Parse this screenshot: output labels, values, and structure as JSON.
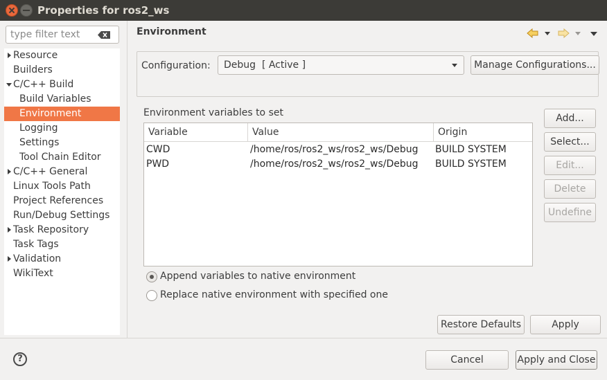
{
  "window": {
    "title": "Properties for ros2_ws"
  },
  "filter": {
    "placeholder": "type filter text"
  },
  "tree": [
    {
      "label": "Resource",
      "expandable": true,
      "expanded": false,
      "level": 0,
      "selected": false
    },
    {
      "label": "Builders",
      "expandable": false,
      "level": 0,
      "selected": false
    },
    {
      "label": "C/C++ Build",
      "expandable": true,
      "expanded": true,
      "level": 0,
      "selected": false
    },
    {
      "label": "Build Variables",
      "expandable": false,
      "level": 1,
      "selected": false
    },
    {
      "label": "Environment",
      "expandable": false,
      "level": 1,
      "selected": true
    },
    {
      "label": "Logging",
      "expandable": false,
      "level": 1,
      "selected": false
    },
    {
      "label": "Settings",
      "expandable": false,
      "level": 1,
      "selected": false
    },
    {
      "label": "Tool Chain Editor",
      "expandable": false,
      "level": 1,
      "selected": false
    },
    {
      "label": "C/C++ General",
      "expandable": true,
      "expanded": false,
      "level": 0,
      "selected": false
    },
    {
      "label": "Linux Tools Path",
      "expandable": false,
      "level": 0,
      "selected": false
    },
    {
      "label": "Project References",
      "expandable": false,
      "level": 0,
      "selected": false
    },
    {
      "label": "Run/Debug Settings",
      "expandable": false,
      "level": 0,
      "selected": false
    },
    {
      "label": "Task Repository",
      "expandable": true,
      "expanded": false,
      "level": 0,
      "selected": false
    },
    {
      "label": "Task Tags",
      "expandable": false,
      "level": 0,
      "selected": false
    },
    {
      "label": "Validation",
      "expandable": true,
      "expanded": false,
      "level": 0,
      "selected": false
    },
    {
      "label": "WikiText",
      "expandable": false,
      "level": 0,
      "selected": false
    }
  ],
  "page": {
    "title": "Environment"
  },
  "config": {
    "label": "Configuration:",
    "selected": "Debug  [ Active ]",
    "manage_label": "Manage Configurations..."
  },
  "env": {
    "section_label": "Environment variables to set",
    "columns": [
      "Variable",
      "Value",
      "Origin"
    ],
    "rows": [
      {
        "variable": "CWD",
        "value": "/home/ros/ros2_ws/ros2_ws/Debug",
        "origin": "BUILD SYSTEM"
      },
      {
        "variable": "PWD",
        "value": "/home/ros/ros2_ws/ros2_ws/Debug",
        "origin": "BUILD SYSTEM"
      }
    ]
  },
  "side_buttons": [
    {
      "label": "Add...",
      "enabled": true
    },
    {
      "label": "Select...",
      "enabled": true
    },
    {
      "label": "Edit...",
      "enabled": false
    },
    {
      "label": "Delete",
      "enabled": false
    },
    {
      "label": "Undefine",
      "enabled": false
    }
  ],
  "options": {
    "append_label": "Append variables to native environment",
    "replace_label": "Replace native environment with specified one",
    "selected": "append"
  },
  "page_buttons": {
    "restore_defaults": "Restore Defaults",
    "apply": "Apply"
  },
  "dialog_buttons": {
    "cancel": "Cancel",
    "apply_close": "Apply and Close"
  },
  "colors": {
    "selection": "#f07746",
    "titlebar": "#3c3b37",
    "close": "#e9683c",
    "nav_arrow": "#e8b23a"
  }
}
